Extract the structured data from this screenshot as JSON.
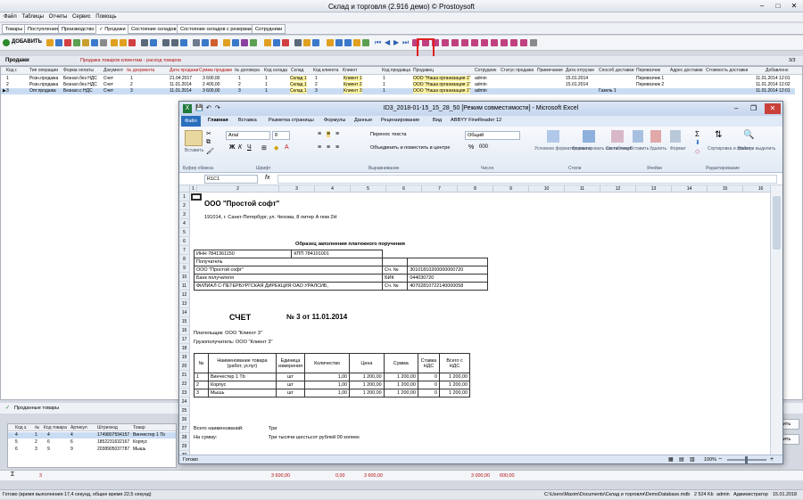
{
  "app": {
    "title": "Склад и торговля (2.916 демо) © Prostoysoft"
  },
  "menu": [
    "Файл",
    "Таблицы",
    "Отчеты",
    "Сервис",
    "Помощь"
  ],
  "tabs": [
    "Товары",
    "Поступления",
    "Производство",
    "✓ Продажи",
    "Состояние складов",
    "Состояние складов с резервами",
    "Сотрудники"
  ],
  "toolbar": {
    "add_label": "ДОБАВИТЬ"
  },
  "section": {
    "title": "Продажи",
    "subtitle": "Продажа товаров клиентам - расход товаров",
    "counter": "3/3"
  },
  "grid": {
    "columns": [
      "Код г.",
      "Тип операции",
      "Форма оплаты",
      "Документ",
      "№ документа",
      "Дата продажи",
      "Сумма продажи",
      "№ договора",
      "Код склада",
      "Склад",
      "Код клиента",
      "Клиент",
      "Код продавца",
      "Продавец",
      "Сотрудник",
      "Статус продажи",
      "Примечание",
      "Дата отгрузки",
      "Способ доставки",
      "Перевозчик",
      "Адрес доставки",
      "Стоимость доставки",
      "Добавлено"
    ],
    "rows": [
      [
        "1",
        "Розн.продажа",
        "Безнал.без НДС",
        "Счет",
        "1",
        "21.04.2017",
        "3 600,00",
        "1",
        "1",
        "Склад 1",
        "1",
        "Клиент 1",
        "1",
        "ООО \"Наша организация 1\"",
        "admin",
        "",
        "",
        "15.01.2014",
        "",
        "Перевозчик 1",
        "",
        "",
        "11.01.2014 12:01"
      ],
      [
        "2",
        "Розн.продажа",
        "Безнал.без НДС",
        "Счет",
        "2",
        "11.01.2014",
        "2 400,00",
        "2",
        "1",
        "Склад 1",
        "2",
        "Клиент 2",
        "1",
        "ООО \"Наша организация 1\"",
        "admin",
        "",
        "",
        "15.01.2014",
        "",
        "Перевозчик 2",
        "",
        "",
        "11.01.2014 12:02"
      ],
      [
        "3",
        "Опт.продажа",
        "Безнал.с НДС",
        "Счет",
        "3",
        "11.01.2014",
        "3 600,00",
        "3",
        "1",
        "Склад 1",
        "3",
        "Клиент 3",
        "1",
        "ООО \"Наша организация 1\"",
        "admin",
        "",
        "",
        "",
        "Газель 1",
        "",
        "",
        "",
        "11.01.2014 12:01"
      ]
    ]
  },
  "bottom": {
    "tab_label": "Проданные товары",
    "columns": [
      "Код з.",
      "№",
      "Код товара",
      "Артикул",
      "Штрихкод",
      "Товар"
    ],
    "rows": [
      [
        "4",
        "1",
        "4",
        "4",
        "1749807594157",
        "Винчестер 1 Tb"
      ],
      [
        "5",
        "2",
        "6",
        "6",
        "1852231632167",
        "Корпус"
      ],
      [
        "6",
        "3",
        "9",
        "9",
        "2038905037787",
        "Мышь"
      ]
    ],
    "action_label": "ить"
  },
  "sums": {
    "count": "3",
    "total": "3 600,00",
    "s2": "0,00",
    "s3": "3 600,00",
    "s4": "3 000,00",
    "s5": "600,00"
  },
  "status": {
    "left": "Готово (время выполнения 17,4 секунд, общее время 22,5 секунд)",
    "db": "C:\\Users\\Maxim\\Documents\\Склад и торговля\\DemoDatabase.mdb",
    "size": "2 524 Kb",
    "user": "admin",
    "role": "Администратор",
    "date": "15.01.2018"
  },
  "excel": {
    "title": "ID3_2018-01-15_15_28_50  [Режим совместимости] - Microsoft Excel",
    "menu": [
      "Файл",
      "Главная",
      "Вставка",
      "Разметка страницы",
      "Формулы",
      "Данные",
      "Рецензирование",
      "Вид",
      "ABBYY FineReader 12"
    ],
    "font": "Arial",
    "size": "8",
    "number_format": "Общий",
    "wrap_label": "Перенос текста",
    "merge_label": "Объединить и поместить в центре",
    "groups": [
      "Буфер обмена",
      "Шрифт",
      "Выравнивание",
      "Число",
      "Стили",
      "Ячейки",
      "Редактирование"
    ],
    "ribbon_buttons": [
      "Вставить",
      "Условное форматирование",
      "Форматировать как таблицу",
      "Стили ячеек",
      "Вставить",
      "Удалить",
      "Формат",
      "Сортировка и фильтр",
      "Найти и выделить"
    ],
    "cell_ref": "R1C1",
    "company": "ООО \"Простой софт\"",
    "address": "191014, г. Санкт-Петербург, ул. Чехова, 8 литер А пом 2Н",
    "payment_title": "Образец заполнения платежного поручения",
    "inn": "ИНН 7841361150",
    "kpp": "КПП 784101001",
    "recipient_label": "Получатель",
    "recipient": "ООО \"Простой софт\"",
    "bank_label": "Банк получателя",
    "bank": "ФИЛИАЛ С-ПЕТЕРБУРГСКАЯ ДИРЕКЦИЯ ОАО УРАЛСИБ,",
    "acc_label": "Сч. №",
    "acc": "30101810200000000720",
    "bik_label": "БИК",
    "bik": "044030720",
    "acc2": "40702810722140000058",
    "invoice_title": "СЧЕТ",
    "invoice_no": "№    3  от  11.01.2014",
    "payer": "Плательщик: ООО \"Клиент 3\"",
    "consignee": "Грузополучатель: ООО \"Клиент 3\"",
    "table_head": [
      "№",
      "Наименование товара (работ, услуг)",
      "Единица измерения",
      "Количество",
      "Цена",
      "Сумма",
      "Ставка НДС",
      "Всего с НДС"
    ],
    "table_rows": [
      [
        "1",
        "Винчестер 1 Tb",
        "шт",
        "1,00",
        "1 200,00",
        "1 200,00",
        "0",
        "1 200,00"
      ],
      [
        "2",
        "Корпус",
        "шт",
        "1,00",
        "1 200,00",
        "1 200,00",
        "0",
        "1 200,00"
      ],
      [
        "3",
        "Мышь",
        "шт",
        "1,00",
        "1 200,00",
        "1 200,00",
        "0",
        "1 200,00"
      ]
    ],
    "total_label": "Всего наименований:",
    "total_value": "Три",
    "sum_label": "На сумму:",
    "sum_value": "Три тысячи шестьсот рублей 00 копеек",
    "status": "Готово",
    "zoom": "100%",
    "row_numbers": [
      "1",
      "2",
      "3",
      "4",
      "5",
      "6",
      "7",
      "8",
      "9",
      "10",
      "11",
      "12",
      "13",
      "14",
      "15",
      "16",
      "17",
      "18",
      "19",
      "20",
      "21",
      "22",
      "23",
      "24",
      "25",
      "26",
      "27",
      "28",
      "29",
      "30"
    ],
    "col_numbers": [
      "1",
      "2",
      "3",
      "4",
      "5",
      "6",
      "7",
      "8",
      "9",
      "10",
      "11",
      "12",
      "13",
      "14",
      "15",
      "16"
    ]
  }
}
